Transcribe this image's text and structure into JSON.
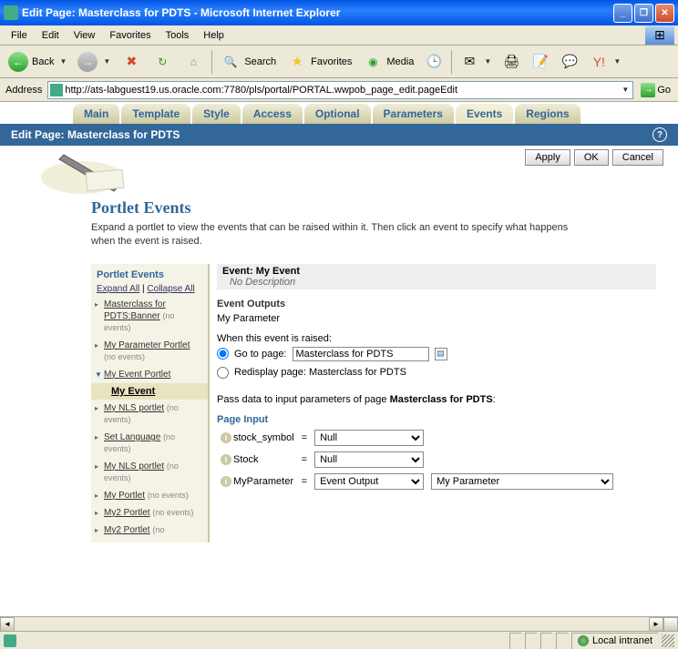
{
  "window": {
    "title": "Edit Page: Masterclass for PDTS - Microsoft Internet Explorer"
  },
  "menubar": {
    "items": [
      "File",
      "Edit",
      "View",
      "Favorites",
      "Tools",
      "Help"
    ]
  },
  "toolbar": {
    "back": "Back",
    "search": "Search",
    "favorites": "Favorites",
    "media": "Media"
  },
  "addrbar": {
    "label": "Address",
    "url": "http://ats-labguest19.us.oracle.com:7780/pls/portal/PORTAL.wwpob_page_edit.pageEdit",
    "go": "Go"
  },
  "tabs": {
    "items": [
      "Main",
      "Template",
      "Style",
      "Access",
      "Optional",
      "Parameters",
      "Events",
      "Regions"
    ],
    "active": "Events"
  },
  "page": {
    "header": "Edit Page: Masterclass for PDTS",
    "buttons": {
      "apply": "Apply",
      "ok": "OK",
      "cancel": "Cancel"
    },
    "section_title": "Portlet Events",
    "section_desc": "Expand a portlet to view the events that can be raised within it. Then click an event to specify what happens when the event is raised."
  },
  "left": {
    "title": "Portlet Events",
    "expand": "Expand All",
    "collapse": "Collapse All",
    "portlets": [
      {
        "name": "Masterclass for PDTS:Banner",
        "note": "(no events)",
        "expanded": false
      },
      {
        "name": "My Parameter Portlet",
        "note": "(no events)",
        "expanded": false
      },
      {
        "name": "My Event Portlet",
        "note": "",
        "expanded": true,
        "event": "My Event"
      },
      {
        "name": "My NLS portlet",
        "note": "(no events)",
        "expanded": false
      },
      {
        "name": "Set Language",
        "note": "(no events)",
        "expanded": false
      },
      {
        "name": "My NLS portlet",
        "note": "(no events)",
        "expanded": false
      },
      {
        "name": "My Portlet",
        "note": "(no events)",
        "expanded": false
      },
      {
        "name": "My2 Portlet",
        "note": "(no events)",
        "expanded": false
      },
      {
        "name": "My2 Portlet",
        "note": "(no",
        "expanded": false
      }
    ]
  },
  "right": {
    "event_label": "Event:",
    "event_name": "My Event",
    "event_desc": "No Description",
    "outputs_heading": "Event Outputs",
    "outputs_param": "My Parameter",
    "raised_heading": "When this event is raised:",
    "goto_label": "Go to page:",
    "goto_value": "Masterclass for PDTS",
    "redisplay_label": "Redisplay page: Masterclass for PDTS",
    "pass_prefix": "Pass data to input parameters of page ",
    "pass_page": "Masterclass for PDTS",
    "page_input_heading": "Page Input",
    "params": [
      {
        "name": "stock_symbol",
        "type": "Null",
        "value": ""
      },
      {
        "name": "Stock",
        "type": "Null",
        "value": ""
      },
      {
        "name": "MyParameter",
        "type": "Event Output",
        "value": "My Parameter"
      }
    ]
  },
  "statusbar": {
    "zone": "Local intranet"
  }
}
